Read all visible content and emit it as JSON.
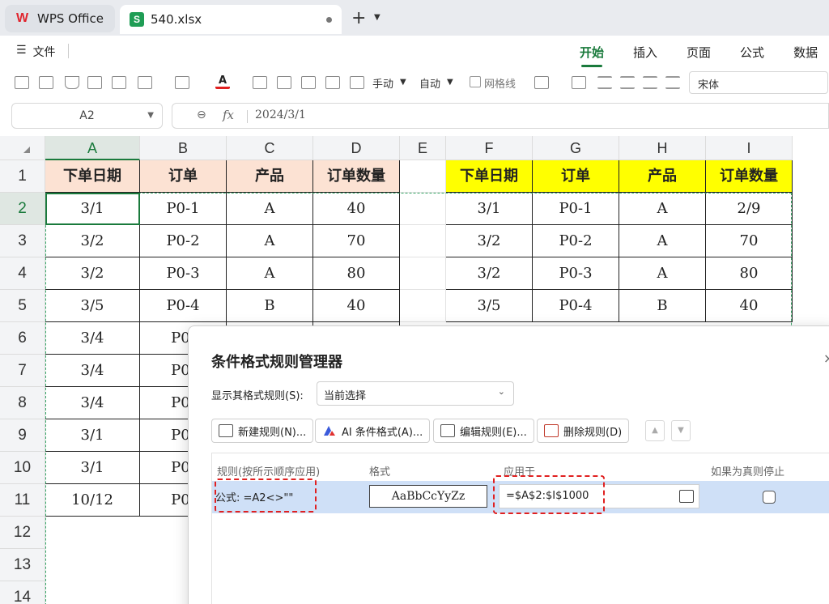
{
  "titlebar": {
    "app_tab": "WPS Office",
    "file_tab": "540.xlsx",
    "file_icon": "S"
  },
  "menu": {
    "file_label": "文件",
    "tabs": [
      "开始",
      "插入",
      "页面",
      "公式",
      "数据"
    ]
  },
  "toolbar": {
    "manual_label": "手动",
    "auto_label": "自动",
    "gridlines_label": "网格线",
    "font_name": "宋体"
  },
  "formula_bar": {
    "cell_ref": "A2",
    "fx": "fx",
    "value": "2024/3/1"
  },
  "grid": {
    "columns": [
      "A",
      "B",
      "C",
      "D",
      "E",
      "F",
      "G",
      "H",
      "I"
    ],
    "rows": [
      "1",
      "2",
      "3",
      "4",
      "5",
      "6",
      "7",
      "8",
      "9",
      "10",
      "11",
      "12",
      "13",
      "14"
    ],
    "left_table": {
      "headers": [
        "下单日期",
        "订单",
        "产品",
        "订单数量"
      ],
      "rows": [
        [
          "3/1",
          "P0-1",
          "A",
          "40"
        ],
        [
          "3/2",
          "P0-2",
          "A",
          "70"
        ],
        [
          "3/2",
          "P0-3",
          "A",
          "80"
        ],
        [
          "3/5",
          "P0-4",
          "B",
          "40"
        ],
        [
          "3/4",
          "P0-",
          "",
          ""
        ],
        [
          "3/4",
          "P0-",
          "",
          ""
        ],
        [
          "3/4",
          "P0-",
          "",
          ""
        ],
        [
          "3/1",
          "P0-",
          "",
          ""
        ],
        [
          "3/1",
          "P0-",
          "",
          ""
        ],
        [
          "10/12",
          "P0-",
          "",
          ""
        ]
      ]
    },
    "right_table": {
      "headers": [
        "下单日期",
        "订单",
        "产品",
        "订单数量"
      ],
      "rows": [
        [
          "3/1",
          "P0-1",
          "A",
          "2/9"
        ],
        [
          "3/2",
          "P0-2",
          "A",
          "70"
        ],
        [
          "3/2",
          "P0-3",
          "A",
          "80"
        ],
        [
          "3/5",
          "P0-4",
          "B",
          "40"
        ]
      ]
    }
  },
  "dialog": {
    "title": "条件格式规则管理器",
    "close": "×",
    "show_rules_label": "显示其格式规则(S):",
    "show_rules_value": "当前选择",
    "buttons": {
      "new_rule": "新建规则(N)...",
      "ai_format": "AI 条件格式(A)...",
      "edit_rule": "编辑规则(E)...",
      "delete_rule": "删除规则(D)"
    },
    "columns": {
      "rule": "规则(按所示顺序应用)",
      "format": "格式",
      "applies_to": "应用于",
      "stop_if_true": "如果为真则停止"
    },
    "rule": {
      "formula": "公式: =A2<>\"\"",
      "preview": "AaBbCcYyZz",
      "applies_to": "=$A$2:$I$1000"
    }
  }
}
